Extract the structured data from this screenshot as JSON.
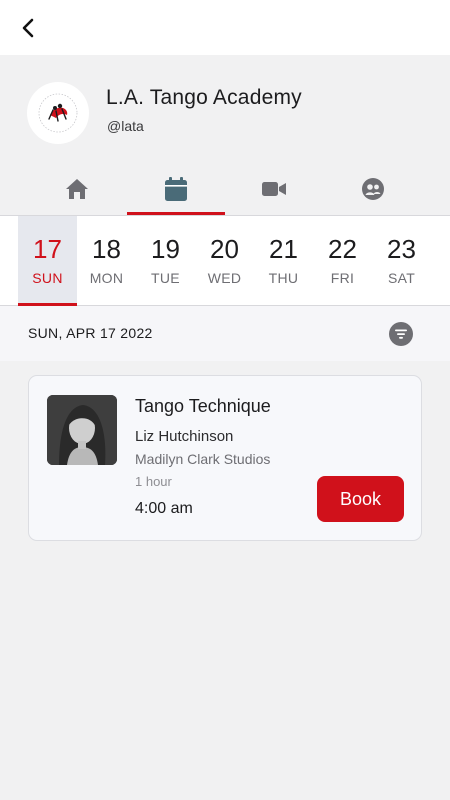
{
  "header": {
    "back_icon": "chevron-left-icon"
  },
  "profile": {
    "name": "L.A. Tango Academy",
    "handle": "@lata",
    "logo_icon": "tango-dancers-logo"
  },
  "tabs": [
    {
      "icon": "home-icon",
      "active": false
    },
    {
      "icon": "calendar-icon",
      "active": true
    },
    {
      "icon": "video-icon",
      "active": false
    },
    {
      "icon": "community-icon",
      "active": false
    }
  ],
  "days": [
    {
      "num": "17",
      "name": "SUN",
      "active": true
    },
    {
      "num": "18",
      "name": "MON",
      "active": false
    },
    {
      "num": "19",
      "name": "TUE",
      "active": false
    },
    {
      "num": "20",
      "name": "WED",
      "active": false
    },
    {
      "num": "21",
      "name": "THU",
      "active": false
    },
    {
      "num": "22",
      "name": "FRI",
      "active": false
    },
    {
      "num": "23",
      "name": "SAT",
      "active": false
    }
  ],
  "date_bar": {
    "label": "SUN, APR 17 2022",
    "filter_icon": "filter-icon"
  },
  "classes": [
    {
      "title": "Tango Technique",
      "instructor": "Liz Hutchinson",
      "studio": "Madilyn Clark Studios",
      "duration": "1 hour",
      "time": "4:00 am",
      "button": "Book"
    }
  ],
  "colors": {
    "accent": "#d0111b",
    "icon_gray": "#6e6e73",
    "active_tab_icon": "#4a6b78",
    "background": "#f1f1f2"
  }
}
